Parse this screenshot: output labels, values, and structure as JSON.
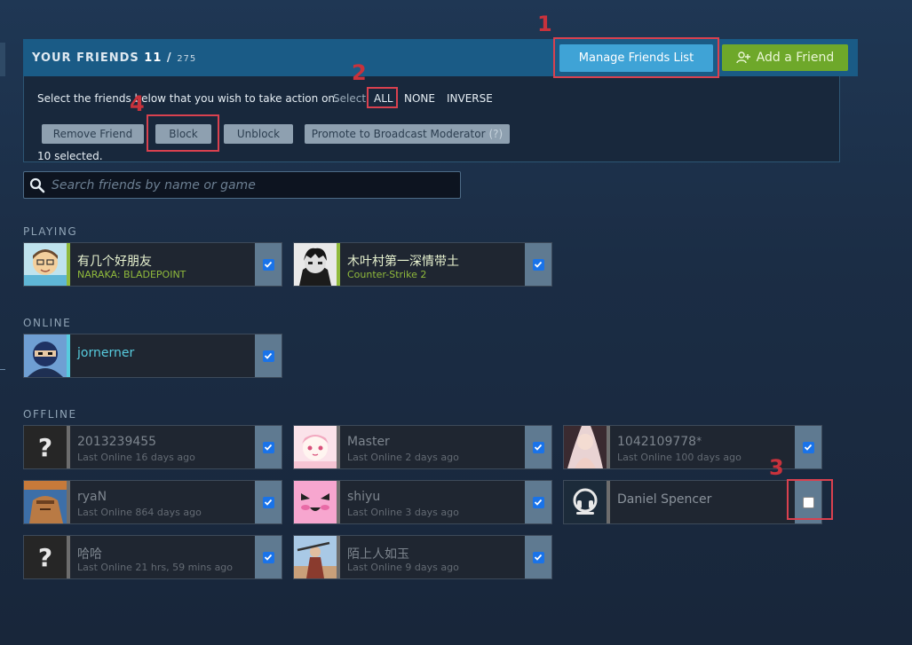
{
  "header": {
    "title": "YOUR FRIENDS",
    "count": "11",
    "separator": "/",
    "total": "275",
    "manage_label": "Manage Friends List",
    "add_label": "Add a Friend"
  },
  "actions": {
    "instruction": "Select the friends below that you wish to take action on.",
    "select_label": "Select:",
    "select_options": [
      "ALL",
      "NONE",
      "INVERSE"
    ],
    "buttons": {
      "remove": "Remove Friend",
      "block": "Block",
      "unblock": "Unblock",
      "promote": "Promote to Broadcast Moderator",
      "promote_help": "(?)"
    },
    "selected_text": "10 selected."
  },
  "search": {
    "placeholder": "Search friends by name or game"
  },
  "sections": {
    "playing": "PLAYING",
    "online": "ONLINE",
    "offline": "OFFLINE"
  },
  "friends": {
    "playing": [
      {
        "name": "有几个好朋友",
        "status": "NARAKA: BLADEPOINT",
        "checked": true
      },
      {
        "name": "木叶村第一深情带土",
        "status": "Counter-Strike 2",
        "checked": true
      }
    ],
    "online": [
      {
        "name": "jornerner",
        "checked": true
      }
    ],
    "offline": [
      {
        "name": "2013239455",
        "status": "Last Online 16 days ago",
        "checked": true
      },
      {
        "name": "Master",
        "status": "Last Online 2 days ago",
        "checked": true
      },
      {
        "name": "1042109778",
        "nick_mark": "*",
        "status": "Last Online 100 days ago",
        "checked": true
      },
      {
        "name": "ryaN",
        "status": "Last Online 864 days ago",
        "checked": true
      },
      {
        "name": "shiyu",
        "status": "Last Online 3 days ago",
        "checked": true
      },
      {
        "name": "Daniel Spencer",
        "checked": false
      },
      {
        "name": "哈哈",
        "status": "Last Online 21 hrs, 59 mins ago",
        "checked": true
      },
      {
        "name": "陌上人如玉",
        "status": "Last Online 9 days ago",
        "checked": true
      }
    ]
  },
  "annotations": [
    "1",
    "2",
    "3",
    "4"
  ],
  "colors": {
    "header_bg": "#1a5b86",
    "manage_btn": "#3fa3d6",
    "add_btn": "#6ea82a",
    "playing": "#90ba3c",
    "online": "#57cbde",
    "checkbox": "#1a73e8",
    "annotation": "#d9414f"
  },
  "icons": {
    "search": "search-icon",
    "add_friend": "add-person-icon",
    "check": "check-icon",
    "unknown_avatar": "question-mark-icon",
    "headset_avatar": "headset-icon"
  }
}
